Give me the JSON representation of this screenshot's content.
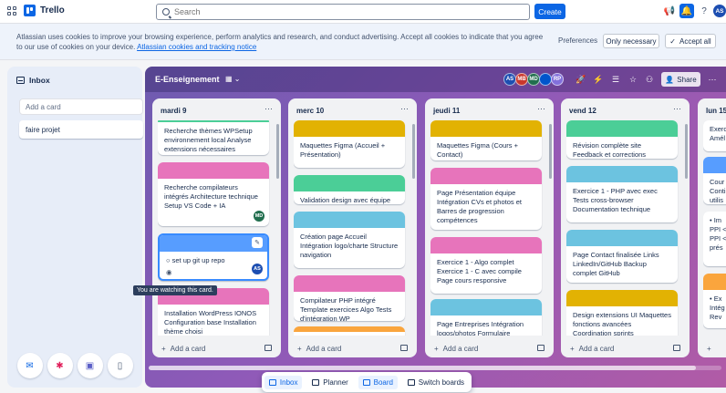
{
  "topbar": {
    "app_name": "Trello",
    "search_placeholder": "Search",
    "create_label": "Create",
    "user_initials": "AS"
  },
  "cookie": {
    "text": "Atlassian uses cookies to improve your browsing experience, perform analytics and research, and conduct advertising. Accept all cookies to indicate that you agree to our use of cookies on your device.",
    "link": "Atlassian cookies and tracking notice",
    "preferences": "Preferences",
    "only_necessary": "Only necessary",
    "accept_all": "Accept all"
  },
  "inbox": {
    "title": "Inbox",
    "add_placeholder": "Add a card",
    "cards": [
      "faire projet"
    ]
  },
  "board": {
    "title": "E-Enseignement",
    "share_label": "Share",
    "members": [
      {
        "initials": "AS",
        "color": "#1d4eb1"
      },
      {
        "initials": "MB",
        "color": "#c9372c"
      },
      {
        "initials": "MD",
        "color": "#216e4e"
      },
      {
        "initials": "",
        "color": "#0055cc"
      },
      {
        "initials": "RP",
        "color": "#8270db"
      }
    ],
    "add_card_label": "Add a card",
    "tooltip": "You are watching this card.",
    "lists": [
      {
        "title": "mardi 9",
        "cards": [
          {
            "cover": "#4bce97",
            "text": "Recherche thèmes WPSetup environnement local Analyse extensions nécessaires"
          },
          {
            "cover": "#e774bb",
            "text": "Recherche compilateurs intégrés Architecture technique Setup VS Code + IA",
            "avatar": "MD",
            "avatar_color": "#216e4e"
          },
          {
            "cover": "#579dff",
            "text": "set up git up repo",
            "avatar": "AS",
            "avatar_color": "#1d4eb1",
            "active": true
          },
          {
            "cover": "#e774bb",
            "text": "Installation WordPress IONOS Configuration base Installation thème choisi"
          }
        ]
      },
      {
        "title": "merc 10",
        "cards": [
          {
            "cover": "#e2b203",
            "text": "Maquettes Figma (Accueil + Présentation)"
          },
          {
            "cover": "#4bce97",
            "text": "Validation design avec équipe"
          },
          {
            "cover": "#6cc3e0",
            "text": "Création page Accueil Intégration logo/charte Structure navigation"
          },
          {
            "cover": "#e774bb",
            "text": "Compilateur PHP intégré Template exercices Algo Tests d'intégration WP"
          },
          {
            "cover": "#faa53d",
            "text": ""
          }
        ]
      },
      {
        "title": "jeudi 11",
        "cards": [
          {
            "cover": "#e2b203",
            "text": "Maquettes Figma (Cours + Contact)"
          },
          {
            "cover": "#e774bb",
            "text": "Page Présentation équipe Intégration CVs et photos et Barres de progression compétences"
          },
          {
            "cover": "#e774bb",
            "text": "Exercice 1 - Algo complet Exercice 1 - C avec compile Page cours responsive"
          },
          {
            "cover": "#6cc3e0",
            "text": "Page Entreprises Intégration logos/photos Formulaire"
          }
        ]
      },
      {
        "title": "vend 12",
        "cards": [
          {
            "cover": "#4bce97",
            "text": "Révision complète site Feedback et corrections"
          },
          {
            "cover": "#6cc3e0",
            "text": "Exercice 1 - PHP avec exec Tests cross-browser Documentation technique"
          },
          {
            "cover": "#6cc3e0",
            "text": "Page Contact finalisée Links LinkedIn/GitHub Backup complet GitHub"
          },
          {
            "cover": "#e2b203",
            "text": "Design extensions UI Maquettes fonctions avancées Coordination sprints"
          }
        ]
      },
      {
        "title": "lun 15",
        "cards": [
          {
            "cover": "",
            "text": "Exerc Amél"
          },
          {
            "cover": "#579dff",
            "text": "Cour Conti utilis"
          },
          {
            "cover": "",
            "text": "• Im PPI < PPI < prés"
          },
          {
            "cover": "#faa53d",
            "text": "• Ex Intég • Rev"
          }
        ]
      }
    ]
  },
  "bottomnav": {
    "items": [
      "Inbox",
      "Planner",
      "Board",
      "Switch boards"
    ]
  }
}
